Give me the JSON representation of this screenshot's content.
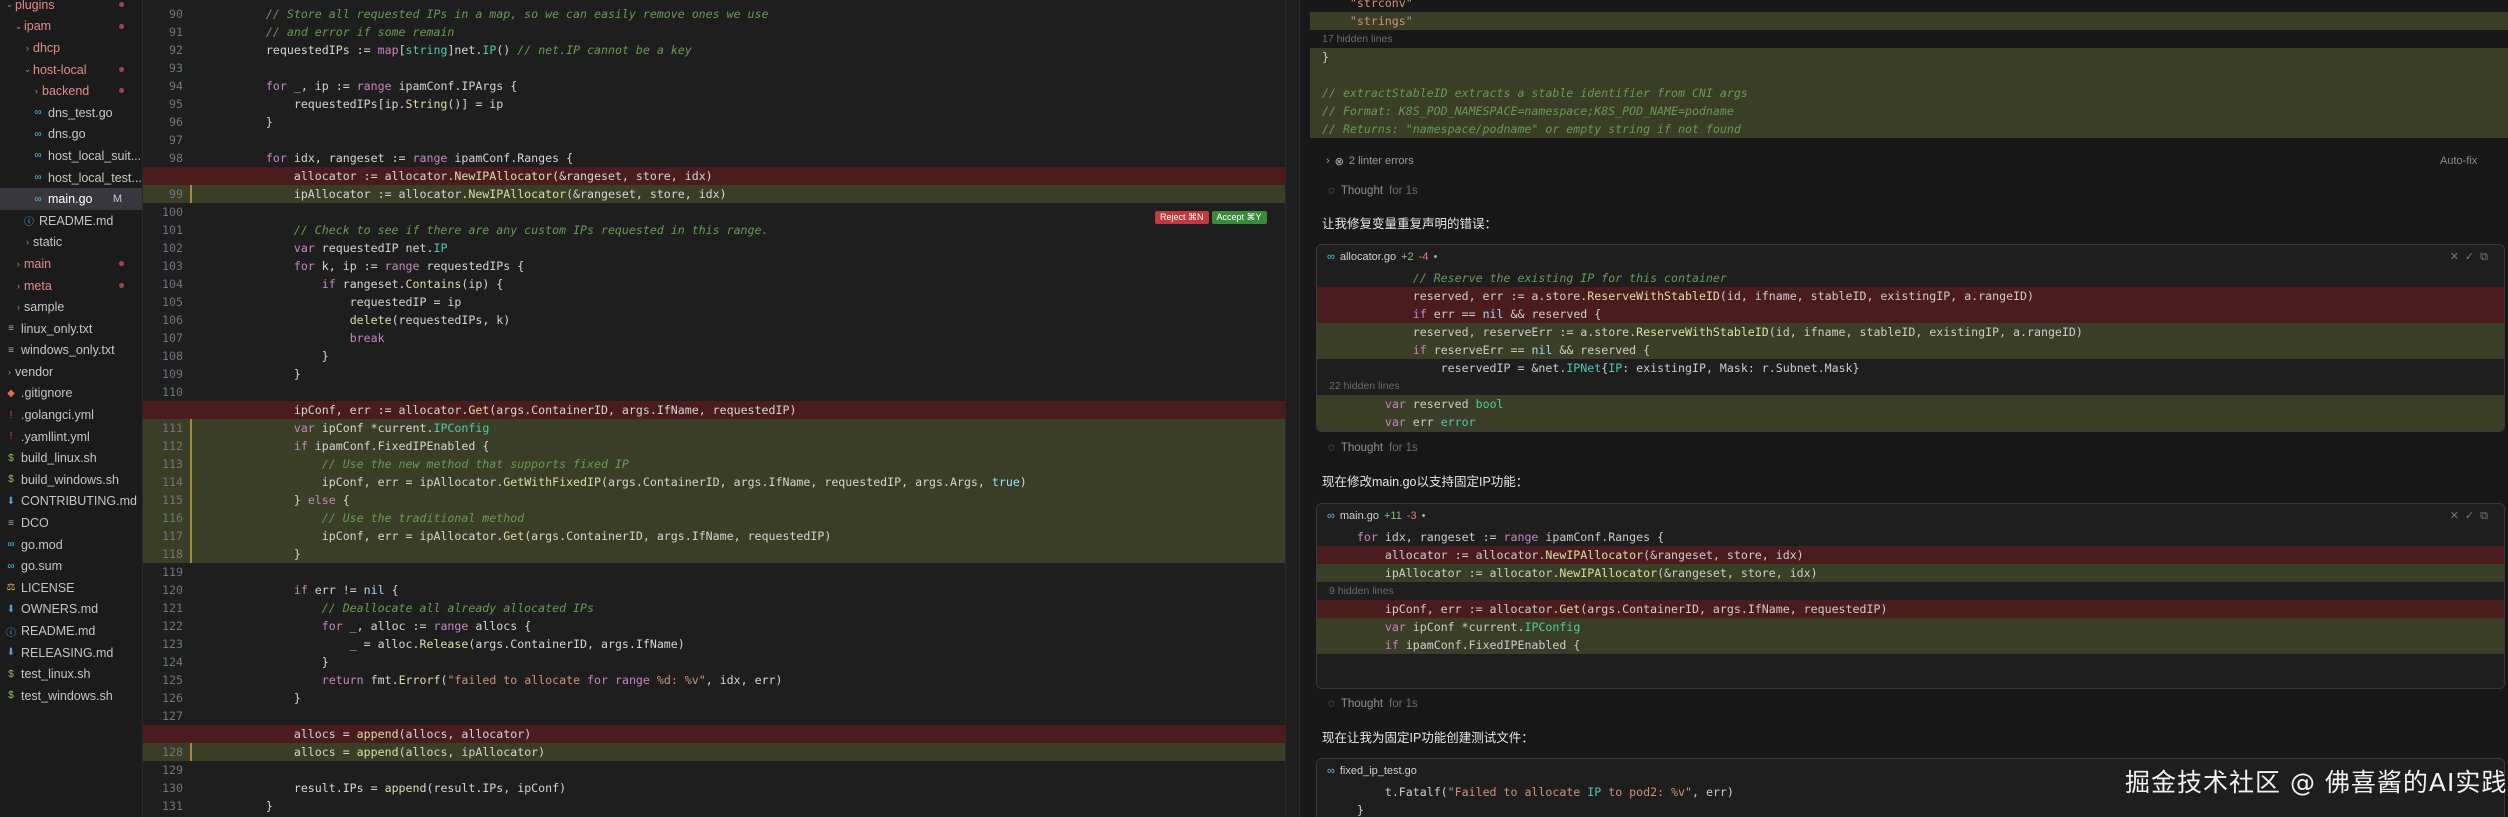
{
  "sidebar": {
    "items": [
      {
        "label": "plugins",
        "indent": 0,
        "chev": "⌄",
        "red": true,
        "dot": true
      },
      {
        "label": "ipam",
        "indent": 1,
        "chev": "⌄",
        "red": true,
        "dot": true
      },
      {
        "label": "dhcp",
        "indent": 2,
        "chev": "›",
        "red": true,
        "dot": false
      },
      {
        "label": "host-local",
        "indent": 2,
        "chev": "⌄",
        "red": true,
        "dot": true
      },
      {
        "label": "backend",
        "indent": 3,
        "chev": "›",
        "red": true,
        "dot": true
      },
      {
        "label": "dns_test.go",
        "indent": 3,
        "icon": "go-file-icon",
        "dot": false
      },
      {
        "label": "dns.go",
        "indent": 3,
        "icon": "go-file-icon",
        "dot": false
      },
      {
        "label": "host_local_suit...",
        "indent": 3,
        "icon": "go-file-icon",
        "dot": false
      },
      {
        "label": "host_local_test...",
        "indent": 3,
        "icon": "go-file-icon",
        "dot": false
      },
      {
        "label": "main.go",
        "indent": 3,
        "icon": "go-file-icon",
        "selected": true,
        "mark": "M"
      },
      {
        "label": "README.md",
        "indent": 2,
        "icon": "info-file-icon",
        "dot": false
      },
      {
        "label": "static",
        "indent": 2,
        "chev": "›",
        "dot": false
      },
      {
        "label": "main",
        "indent": 1,
        "chev": "›",
        "red": true,
        "dot": true
      },
      {
        "label": "meta",
        "indent": 1,
        "chev": "›",
        "red": true,
        "dot": true
      },
      {
        "label": "sample",
        "indent": 1,
        "chev": "›",
        "dot": false
      },
      {
        "label": "linux_only.txt",
        "indent": 0,
        "icon": "text-file-icon",
        "dot": false
      },
      {
        "label": "windows_only.txt",
        "indent": 0,
        "icon": "text-file-icon",
        "dot": false
      },
      {
        "label": "vendor",
        "indent": 0,
        "chev": "›",
        "dot": false
      },
      {
        "label": ".gitignore",
        "indent": 0,
        "icon": "git-file-icon",
        "dot": false
      },
      {
        "label": ".golangci.yml",
        "indent": 0,
        "icon": "yaml-file-icon",
        "dot": false
      },
      {
        "label": ".yamllint.yml",
        "indent": 0,
        "icon": "yaml-file-icon",
        "dot": false
      },
      {
        "label": "build_linux.sh",
        "indent": 0,
        "icon": "shell-file-icon",
        "dot": false
      },
      {
        "label": "build_windows.sh",
        "indent": 0,
        "icon": "shell-file-icon",
        "dot": false
      },
      {
        "label": "CONTRIBUTING.md",
        "indent": 0,
        "icon": "markdown-file-icon",
        "dot": false
      },
      {
        "label": "DCO",
        "indent": 0,
        "icon": "text-file-icon",
        "dot": false
      },
      {
        "label": "go.mod",
        "indent": 0,
        "icon": "go-file-icon",
        "dot": false
      },
      {
        "label": "go.sum",
        "indent": 0,
        "icon": "go-file-icon",
        "dot": false
      },
      {
        "label": "LICENSE",
        "indent": 0,
        "icon": "license-file-icon",
        "dot": false
      },
      {
        "label": "OWNERS.md",
        "indent": 0,
        "icon": "markdown-file-icon",
        "dot": false
      },
      {
        "label": "README.md",
        "indent": 0,
        "icon": "info-file-icon",
        "dot": false
      },
      {
        "label": "RELEASING.md",
        "indent": 0,
        "icon": "markdown-file-icon",
        "dot": false
      },
      {
        "label": "test_linux.sh",
        "indent": 0,
        "icon": "shell-file-icon",
        "dot": false
      },
      {
        "label": "test_windows.sh",
        "indent": 0,
        "icon": "shell-file-icon",
        "dot": false
      }
    ]
  },
  "editor": {
    "reject_label": "Reject ⌘N",
    "accept_label": "Accept ⌘Y",
    "lines": [
      {
        "n": "90",
        "t": "\t// Store all requested IPs in a map, so we can easily remove ones we use",
        "k": "cm"
      },
      {
        "n": "91",
        "t": "\t// and error if some remain",
        "k": "cm"
      },
      {
        "n": "92",
        "t": "\trequestedIPs := map[string]net.IP() // net.IP cannot be a key",
        "k": "n"
      },
      {
        "n": "93",
        "t": "",
        "k": "n"
      },
      {
        "n": "94",
        "t": "\tfor _, ip := range ipamConf.IPArgs {",
        "k": "n"
      },
      {
        "n": "95",
        "t": "\t\trequestedIPs[ip.String()] = ip",
        "k": "n"
      },
      {
        "n": "96",
        "t": "\t}",
        "k": "n"
      },
      {
        "n": "97",
        "t": "",
        "k": "n"
      },
      {
        "n": "98",
        "t": "\tfor idx, rangeset := range ipamConf.Ranges {",
        "k": "n"
      },
      {
        "n": "",
        "t": "\t\tallocator := allocator.NewIPAllocator(&rangeset, store, idx)",
        "k": "del"
      },
      {
        "n": "99",
        "t": "\t\tipAllocator := allocator.NewIPAllocator(&rangeset, store, idx)",
        "k": "add"
      },
      {
        "n": "100",
        "t": "",
        "k": "n"
      },
      {
        "n": "101",
        "t": "\t\t// Check to see if there are any custom IPs requested in this range.",
        "k": "cm"
      },
      {
        "n": "102",
        "t": "\t\tvar requestedIP net.IP",
        "k": "n"
      },
      {
        "n": "103",
        "t": "\t\tfor k, ip := range requestedIPs {",
        "k": "n"
      },
      {
        "n": "104",
        "t": "\t\t\tif rangeset.Contains(ip) {",
        "k": "n"
      },
      {
        "n": "105",
        "t": "\t\t\t\trequestedIP = ip",
        "k": "n"
      },
      {
        "n": "106",
        "t": "\t\t\t\tdelete(requestedIPs, k)",
        "k": "n"
      },
      {
        "n": "107",
        "t": "\t\t\t\tbreak",
        "k": "n"
      },
      {
        "n": "108",
        "t": "\t\t\t}",
        "k": "n"
      },
      {
        "n": "109",
        "t": "\t\t}",
        "k": "n"
      },
      {
        "n": "110",
        "t": "",
        "k": "n"
      },
      {
        "n": "",
        "t": "\t\tipConf, err := allocator.Get(args.ContainerID, args.IfName, requestedIP)",
        "k": "del"
      },
      {
        "n": "111",
        "t": "\t\tvar ipConf *current.IPConfig",
        "k": "add"
      },
      {
        "n": "112",
        "t": "\t\tif ipamConf.FixedIPEnabled {",
        "k": "add"
      },
      {
        "n": "113",
        "t": "\t\t\t// Use the new method that supports fixed IP",
        "k": "addcm"
      },
      {
        "n": "114",
        "t": "\t\t\tipConf, err = ipAllocator.GetWithFixedIP(args.ContainerID, args.IfName, requestedIP, args.Args, true)",
        "k": "add"
      },
      {
        "n": "115",
        "t": "\t\t} else {",
        "k": "add"
      },
      {
        "n": "116",
        "t": "\t\t\t// Use the traditional method",
        "k": "addcm"
      },
      {
        "n": "117",
        "t": "\t\t\tipConf, err = ipAllocator.Get(args.ContainerID, args.IfName, requestedIP)",
        "k": "add"
      },
      {
        "n": "118",
        "t": "\t\t}",
        "k": "add"
      },
      {
        "n": "119",
        "t": "",
        "k": "n"
      },
      {
        "n": "120",
        "t": "\t\tif err != nil {",
        "k": "n"
      },
      {
        "n": "121",
        "t": "\t\t\t// Deallocate all already allocated IPs",
        "k": "cm"
      },
      {
        "n": "122",
        "t": "\t\t\tfor _, alloc := range allocs {",
        "k": "n"
      },
      {
        "n": "123",
        "t": "\t\t\t\t_ = alloc.Release(args.ContainerID, args.IfName)",
        "k": "n"
      },
      {
        "n": "124",
        "t": "\t\t\t}",
        "k": "n"
      },
      {
        "n": "125",
        "t": "\t\t\treturn fmt.Errorf(\"failed to allocate for range %d: %v\", idx, err)",
        "k": "n"
      },
      {
        "n": "126",
        "t": "\t\t}",
        "k": "n"
      },
      {
        "n": "127",
        "t": "",
        "k": "n"
      },
      {
        "n": "",
        "t": "\t\tallocs = append(allocs, allocator)",
        "k": "del"
      },
      {
        "n": "128",
        "t": "\t\tallocs = append(allocs, ipAllocator)",
        "k": "add"
      },
      {
        "n": "129",
        "t": "",
        "k": "n"
      },
      {
        "n": "130",
        "t": "\t\tresult.IPs = append(result.IPs, ipConf)",
        "k": "n"
      },
      {
        "n": "131",
        "t": "\t}",
        "k": "n"
      }
    ]
  },
  "chat": {
    "top_lines": [
      {
        "t": "    \"strconv\"",
        "k": "n"
      },
      {
        "t": "    \"strings\"",
        "k": "add"
      }
    ],
    "hidden_1": "17 hidden lines",
    "after_hidden_1": [
      {
        "t": "}",
        "k": "add"
      },
      {
        "t": "",
        "k": "add"
      },
      {
        "t": "// extractStableID extracts a stable identifier from CNI args",
        "k": "addcm"
      },
      {
        "t": "// Format: K8S_POD_NAMESPACE=namespace;K8S_POD_NAME=podname",
        "k": "addcm"
      },
      {
        "t": "// Returns: \"namespace/podname\" or empty string if not found",
        "k": "addcm"
      }
    ],
    "linter_errors": "2 linter errors",
    "autofix": "Auto-fix",
    "thought_label": "Thought",
    "thought_time": "for 1s",
    "msg1": "让我修复变量重复声明的错误：",
    "card1": {
      "file": "allocator.go",
      "plus": "+2",
      "minus": "-4",
      "lines": [
        {
          "t": "            // Reserve the existing IP for this container",
          "k": "cm"
        },
        {
          "t": "            reserved, err := a.store.ReserveWithStableID(id, ifname, stableID, existingIP, a.rangeID)",
          "k": "del"
        },
        {
          "t": "            if err == nil && reserved {",
          "k": "del"
        },
        {
          "t": "            reserved, reserveErr := a.store.ReserveWithStableID(id, ifname, stableID, existingIP, a.rangeID)",
          "k": "add"
        },
        {
          "t": "            if reserveErr == nil && reserved {",
          "k": "add"
        },
        {
          "t": "                reservedIP = &net.IPNet{IP: existingIP, Mask: r.Subnet.Mask}",
          "k": "n"
        }
      ],
      "hidden": "22 hidden lines",
      "tail": [
        {
          "t": "        var reserved bool",
          "k": "add"
        },
        {
          "t": "        var err error",
          "k": "add"
        }
      ]
    },
    "msg2": "现在修改main.go以支持固定IP功能：",
    "card2": {
      "file": "main.go",
      "plus": "+11",
      "minus": "-3",
      "lines": [
        {
          "t": "    for idx, rangeset := range ipamConf.Ranges {",
          "k": "n"
        },
        {
          "t": "        allocator := allocator.NewIPAllocator(&rangeset, store, idx)",
          "k": "del"
        },
        {
          "t": "        ipAllocator := allocator.NewIPAllocator(&rangeset, store, idx)",
          "k": "add"
        }
      ],
      "hidden": "9 hidden lines",
      "tail": [
        {
          "t": "        ipConf, err := allocator.Get(args.ContainerID, args.IfName, requestedIP)",
          "k": "del"
        },
        {
          "t": "        var ipConf *current.IPConfig",
          "k": "add"
        },
        {
          "t": "        if ipamConf.FixedIPEnabled {",
          "k": "add"
        }
      ]
    },
    "msg3": "现在让我为固定IP功能创建测试文件：",
    "card3": {
      "file": "fixed_ip_test.go",
      "lines": [
        {
          "t": "        t.Fatalf(\"Failed to allocate IP to pod2: %v\", err)",
          "k": "n"
        },
        {
          "t": "    }",
          "k": "n"
        }
      ]
    }
  },
  "watermark": "掘金技术社区 @ 佛喜酱的AI实践",
  "colors": {
    "del_bg": "#4a1c1e",
    "add_bg": "#3a3e26",
    "sidebar_bg": "#1b1b1c",
    "editor_bg": "#1e1e1e",
    "reject": "#c1383f",
    "accept": "#3a8a3a"
  }
}
